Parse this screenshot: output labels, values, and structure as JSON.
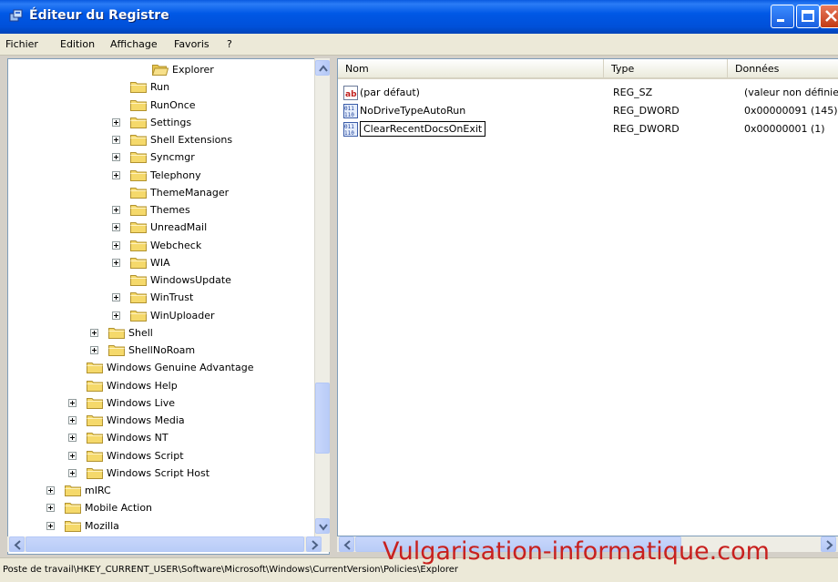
{
  "window": {
    "title": "Éditeur du Registre",
    "controls": [
      "minimize-icon",
      "maximize-icon",
      "close-icon"
    ]
  },
  "menu": [
    "Fichier",
    "Edition",
    "Affichage",
    "Favoris",
    "?"
  ],
  "tree": {
    "items": [
      {
        "label": "Explorer",
        "level": 4,
        "expandable": false,
        "open": true
      },
      {
        "label": "Run",
        "level": 3,
        "expandable": false
      },
      {
        "label": "RunOnce",
        "level": 3,
        "expandable": false
      },
      {
        "label": "Settings",
        "level": 3,
        "expandable": true
      },
      {
        "label": "Shell Extensions",
        "level": 3,
        "expandable": true
      },
      {
        "label": "Syncmgr",
        "level": 3,
        "expandable": true
      },
      {
        "label": "Telephony",
        "level": 3,
        "expandable": true
      },
      {
        "label": "ThemeManager",
        "level": 3,
        "expandable": false
      },
      {
        "label": "Themes",
        "level": 3,
        "expandable": true
      },
      {
        "label": "UnreadMail",
        "level": 3,
        "expandable": true
      },
      {
        "label": "Webcheck",
        "level": 3,
        "expandable": true
      },
      {
        "label": "WIA",
        "level": 3,
        "expandable": true
      },
      {
        "label": "WindowsUpdate",
        "level": 3,
        "expandable": false
      },
      {
        "label": "WinTrust",
        "level": 3,
        "expandable": true
      },
      {
        "label": "WinUploader",
        "level": 3,
        "expandable": true
      },
      {
        "label": "Shell",
        "level": 2,
        "expandable": true
      },
      {
        "label": "ShellNoRoam",
        "level": 2,
        "expandable": true
      },
      {
        "label": "Windows Genuine Advantage",
        "level": 1,
        "expandable": false
      },
      {
        "label": "Windows Help",
        "level": 1,
        "expandable": false
      },
      {
        "label": "Windows Live",
        "level": 1,
        "expandable": true
      },
      {
        "label": "Windows Media",
        "level": 1,
        "expandable": true
      },
      {
        "label": "Windows NT",
        "level": 1,
        "expandable": true
      },
      {
        "label": "Windows Script",
        "level": 1,
        "expandable": true
      },
      {
        "label": "Windows Script Host",
        "level": 1,
        "expandable": true
      },
      {
        "label": "mIRC",
        "level": 0,
        "expandable": true
      },
      {
        "label": "Mobile Action",
        "level": 0,
        "expandable": true
      },
      {
        "label": "Mozilla",
        "level": 0,
        "expandable": true
      }
    ]
  },
  "values": {
    "columns": [
      "Nom",
      "Type",
      "Données"
    ],
    "rows": [
      {
        "name": "(par défaut)",
        "type": "REG_SZ",
        "data": "(valeur non définie)",
        "icon": "string-value-icon"
      },
      {
        "name": "NoDriveTypeAutoRun",
        "type": "REG_DWORD",
        "data": "0x00000091 (145)",
        "icon": "binary-value-icon"
      },
      {
        "name": "ClearRecentDocsOnExit",
        "type": "REG_DWORD",
        "data": "0x00000001 (1)",
        "icon": "binary-value-icon",
        "editing": true
      }
    ]
  },
  "status": {
    "path": "Poste de travail\\HKEY_CURRENT_USER\\Software\\Microsoft\\Windows\\CurrentVersion\\Policies\\Explorer"
  },
  "watermark": "Vulgarisation-informatique.com",
  "colors": {
    "titlebar": "#0055e5",
    "folder": "#f5d96b",
    "watermark": "#c8201e"
  }
}
